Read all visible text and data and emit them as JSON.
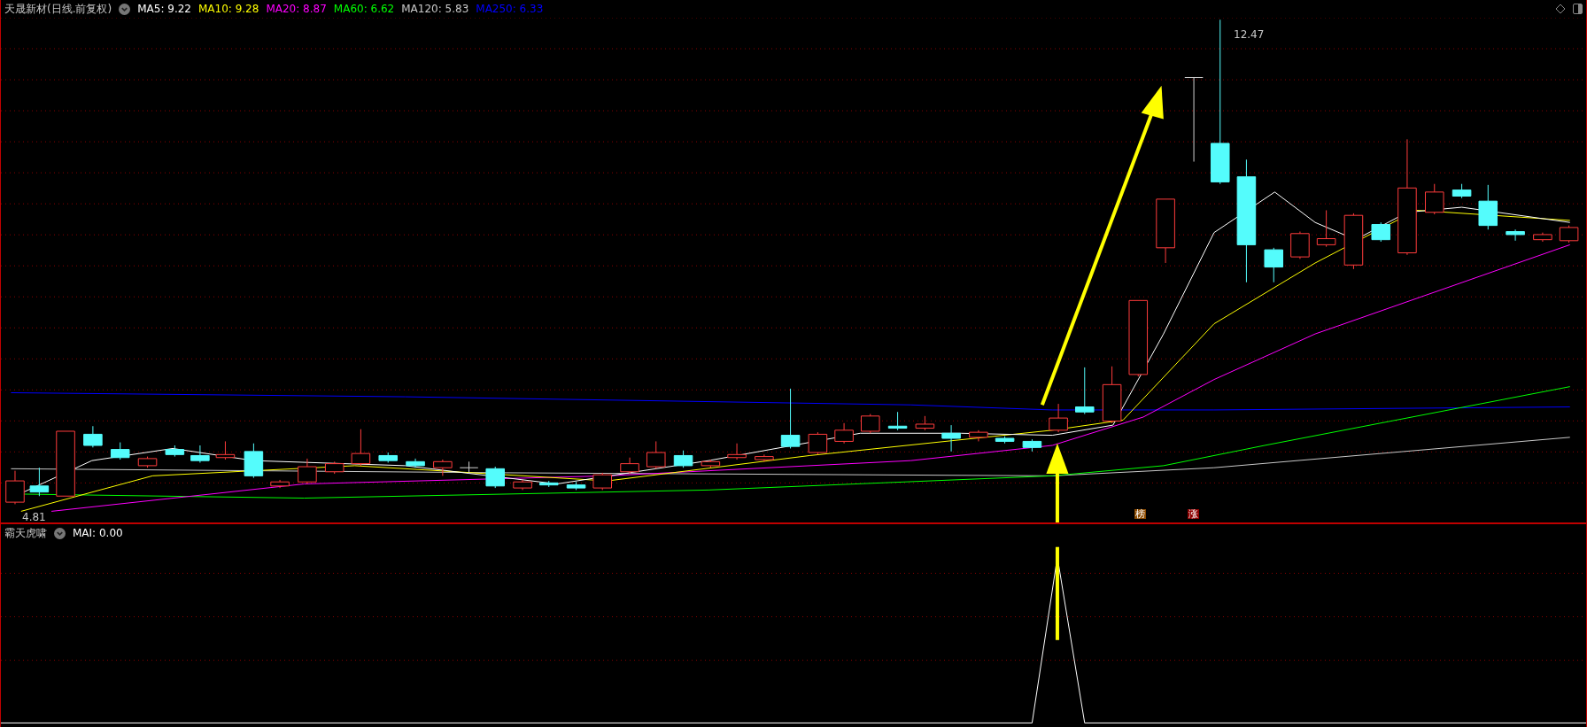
{
  "main_panel": {
    "title": "天晟新材(日线.前复权)",
    "indicators": [
      {
        "label": "MA5: 9.22",
        "color": "#ffffff"
      },
      {
        "label": "MA10: 9.28",
        "color": "#ffff00"
      },
      {
        "label": "MA20: 8.87",
        "color": "#ff00ff"
      },
      {
        "label": "MA60: 6.62",
        "color": "#00ff00"
      },
      {
        "label": "MA120: 5.83",
        "color": "#c8c8c8"
      },
      {
        "label": "MA250: 6.33",
        "color": "#0000ff"
      }
    ],
    "high_label": "12.47",
    "low_label": "4.81",
    "markers": [
      {
        "text": "榜",
        "color": "#8b4a00"
      },
      {
        "text": "涨",
        "color": "#8b0000"
      }
    ]
  },
  "sub_panel": {
    "title": "霸天虎啸",
    "indicators": [
      {
        "label": "MAI: 0.00",
        "color": "#ffffff"
      }
    ]
  }
}
